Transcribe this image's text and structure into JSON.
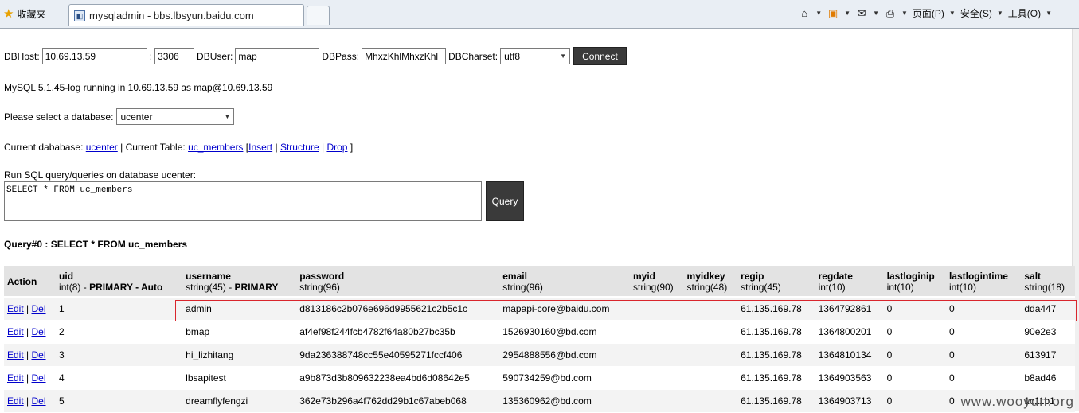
{
  "browser": {
    "favorites_label": "收藏夹",
    "tab_title": "mysqladmin - bbs.lbsyun.baidu.com",
    "menu_page": "页面(P)",
    "menu_safety": "安全(S)",
    "menu_tools": "工具(O)"
  },
  "connect": {
    "host_label": "DBHost:",
    "host": "10.69.13.59",
    "port_sep": ":",
    "port": "3306",
    "user_label": "DBUser:",
    "user": "map",
    "pass_label": "DBPass:",
    "pass": "MhxzKhlMhxzKhl",
    "charset_label": "DBCharset:",
    "charset": "utf8",
    "connect_button": "Connect"
  },
  "status_text": "MySQL 5.1.45-log running in 10.69.13.59 as map@10.69.13.59",
  "select_db": {
    "label": "Please select a database:",
    "value": "ucenter"
  },
  "current": {
    "db_label": "Current dababase:",
    "db": "ucenter",
    "sep1": "| Current Table:",
    "table": "uc_members",
    "open": "[",
    "insert": "Insert",
    "pipe": "|",
    "structure": "Structure",
    "pipe2": "|",
    "drop": "Drop",
    "close": "]"
  },
  "query": {
    "label": "Run SQL query/queries on database ucenter:",
    "sql": "SELECT * FROM uc_members",
    "button": "Query",
    "result_title": "Query#0 : SELECT * FROM uc_members"
  },
  "table": {
    "action_header": "Action",
    "columns": [
      {
        "name": "uid",
        "type": "int(8) - ",
        "extra": "PRIMARY - Auto"
      },
      {
        "name": "username",
        "type": "string(45) - ",
        "extra": "PRIMARY"
      },
      {
        "name": "password",
        "type": "string(96)",
        "extra": ""
      },
      {
        "name": "email",
        "type": "string(96)",
        "extra": ""
      },
      {
        "name": "myid",
        "type": "string(90)",
        "extra": ""
      },
      {
        "name": "myidkey",
        "type": "string(48)",
        "extra": ""
      },
      {
        "name": "regip",
        "type": "string(45)",
        "extra": ""
      },
      {
        "name": "regdate",
        "type": "int(10)",
        "extra": ""
      },
      {
        "name": "lastloginip",
        "type": "int(10)",
        "extra": ""
      },
      {
        "name": "lastlogintime",
        "type": "int(10)",
        "extra": ""
      },
      {
        "name": "salt",
        "type": "string(18)",
        "extra": ""
      }
    ],
    "edit_label": "Edit",
    "action_sep": "|",
    "del_label": "Del",
    "rows": [
      [
        "1",
        "admin",
        "d813186c2b076e696d9955621c2b5c1c",
        "mapapi-core@baidu.com",
        "",
        "",
        "61.135.169.78",
        "1364792861",
        "0",
        "0",
        "dda447"
      ],
      [
        "2",
        "bmap",
        "af4ef98f244fcb4782f64a80b27bc35b",
        "1526930160@bd.com",
        "",
        "",
        "61.135.169.78",
        "1364800201",
        "0",
        "0",
        "90e2e3"
      ],
      [
        "3",
        "hi_lizhitang",
        "9da236388748cc55e40595271fccf406",
        "2954888556@bd.com",
        "",
        "",
        "61.135.169.78",
        "1364810134",
        "0",
        "0",
        "613917"
      ],
      [
        "4",
        "lbsapitest",
        "a9b873d3b809632238ea4bd6d08642e5",
        "590734259@bd.com",
        "",
        "",
        "61.135.169.78",
        "1364903563",
        "0",
        "0",
        "b8ad46"
      ],
      [
        "5",
        "dreamflyfengzi",
        "362e73b296a4f762dd29b1c67abeb068",
        "135360962@bd.com",
        "",
        "",
        "61.135.169.78",
        "1364903713",
        "0",
        "0",
        "1c11b1"
      ]
    ]
  },
  "watermark": "www.wooyun.org"
}
